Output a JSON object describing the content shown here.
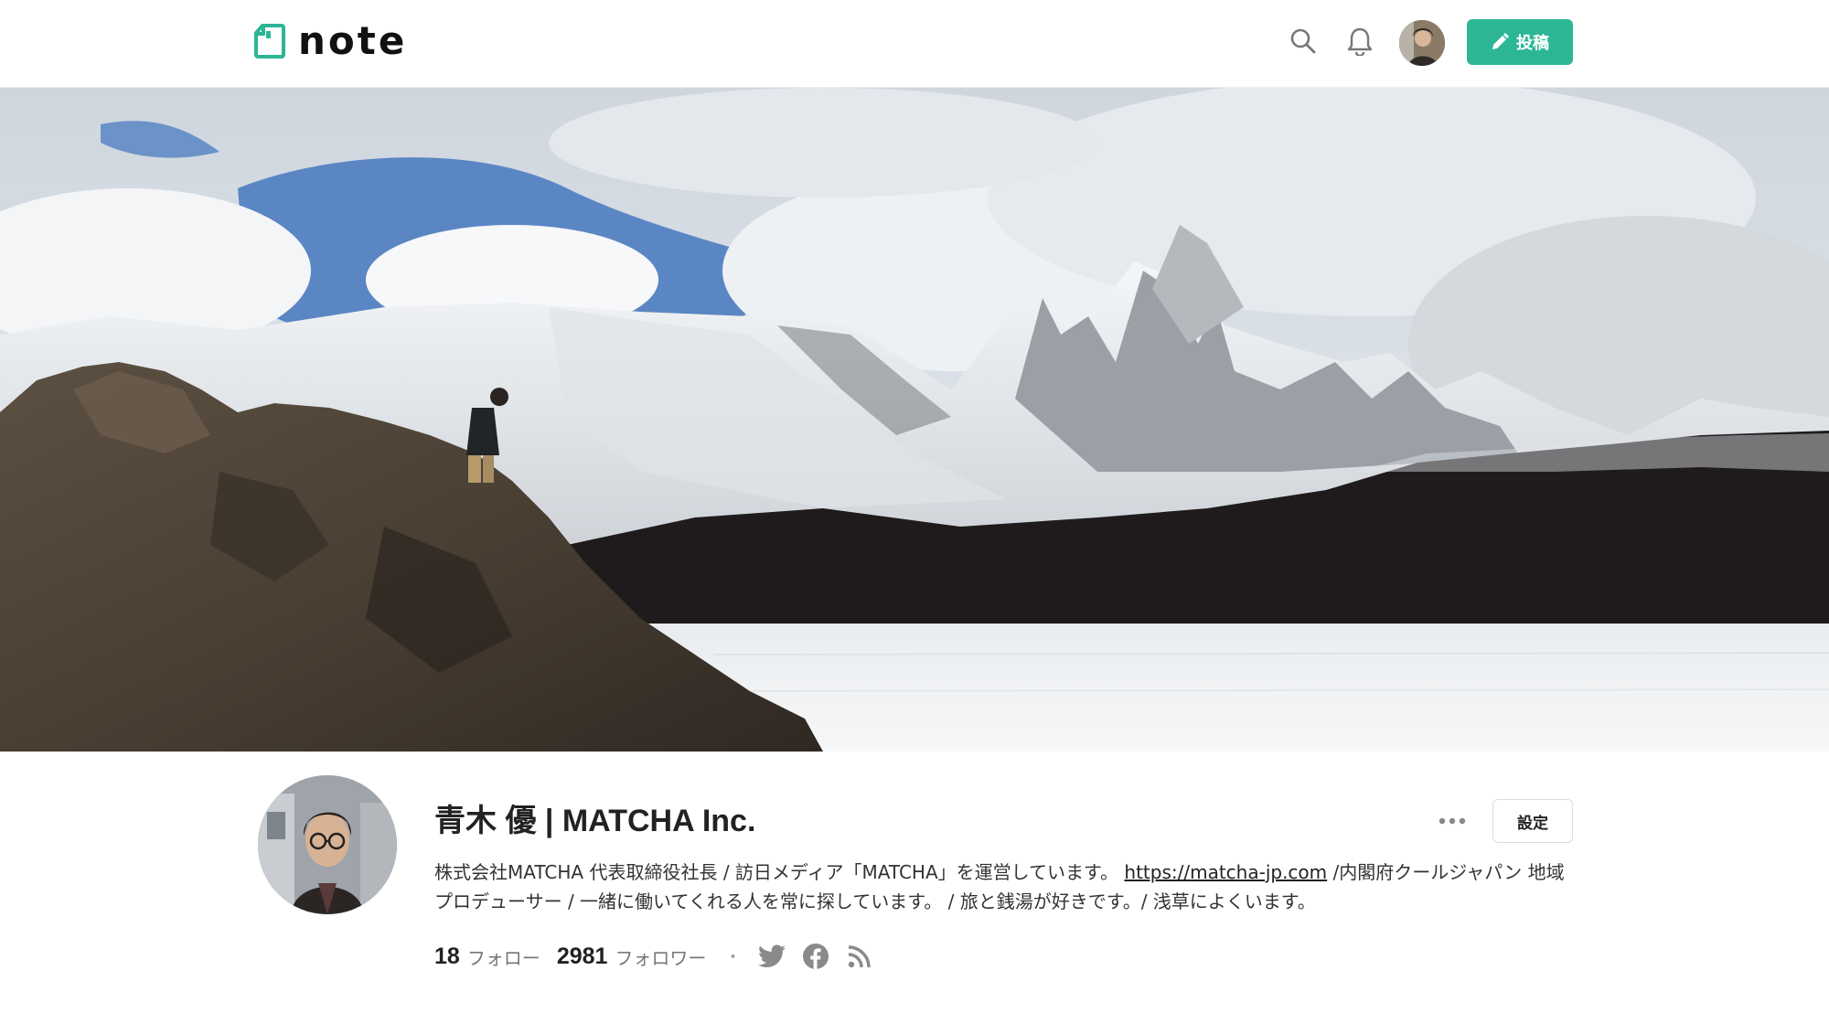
{
  "header": {
    "logo_text": "note",
    "post_button_label": "投稿",
    "accent_color": "#2cb696"
  },
  "profile": {
    "name": "青木 優 | MATCHA Inc.",
    "bio_before_link": "株式会社MATCHA 代表取締役社長 / 訪日メディア「MATCHA」を運営しています。 ",
    "bio_link": "https://matcha-jp.com",
    "bio_after_link": " /内閣府クールジャパン 地域プロデューサー / 一緒に働いてくれる人を常に探しています。 / 旅と銭湯が好きです。/ 浅草によくいます。",
    "settings_label": "設定",
    "following_count": "18",
    "following_label": "フォロー",
    "followers_count": "2981",
    "followers_label": "フォロワー",
    "separator": "・"
  },
  "icons": [
    "search-icon",
    "bell-icon",
    "pencil-icon",
    "more-icon",
    "twitter-icon",
    "facebook-icon",
    "rss-icon"
  ]
}
